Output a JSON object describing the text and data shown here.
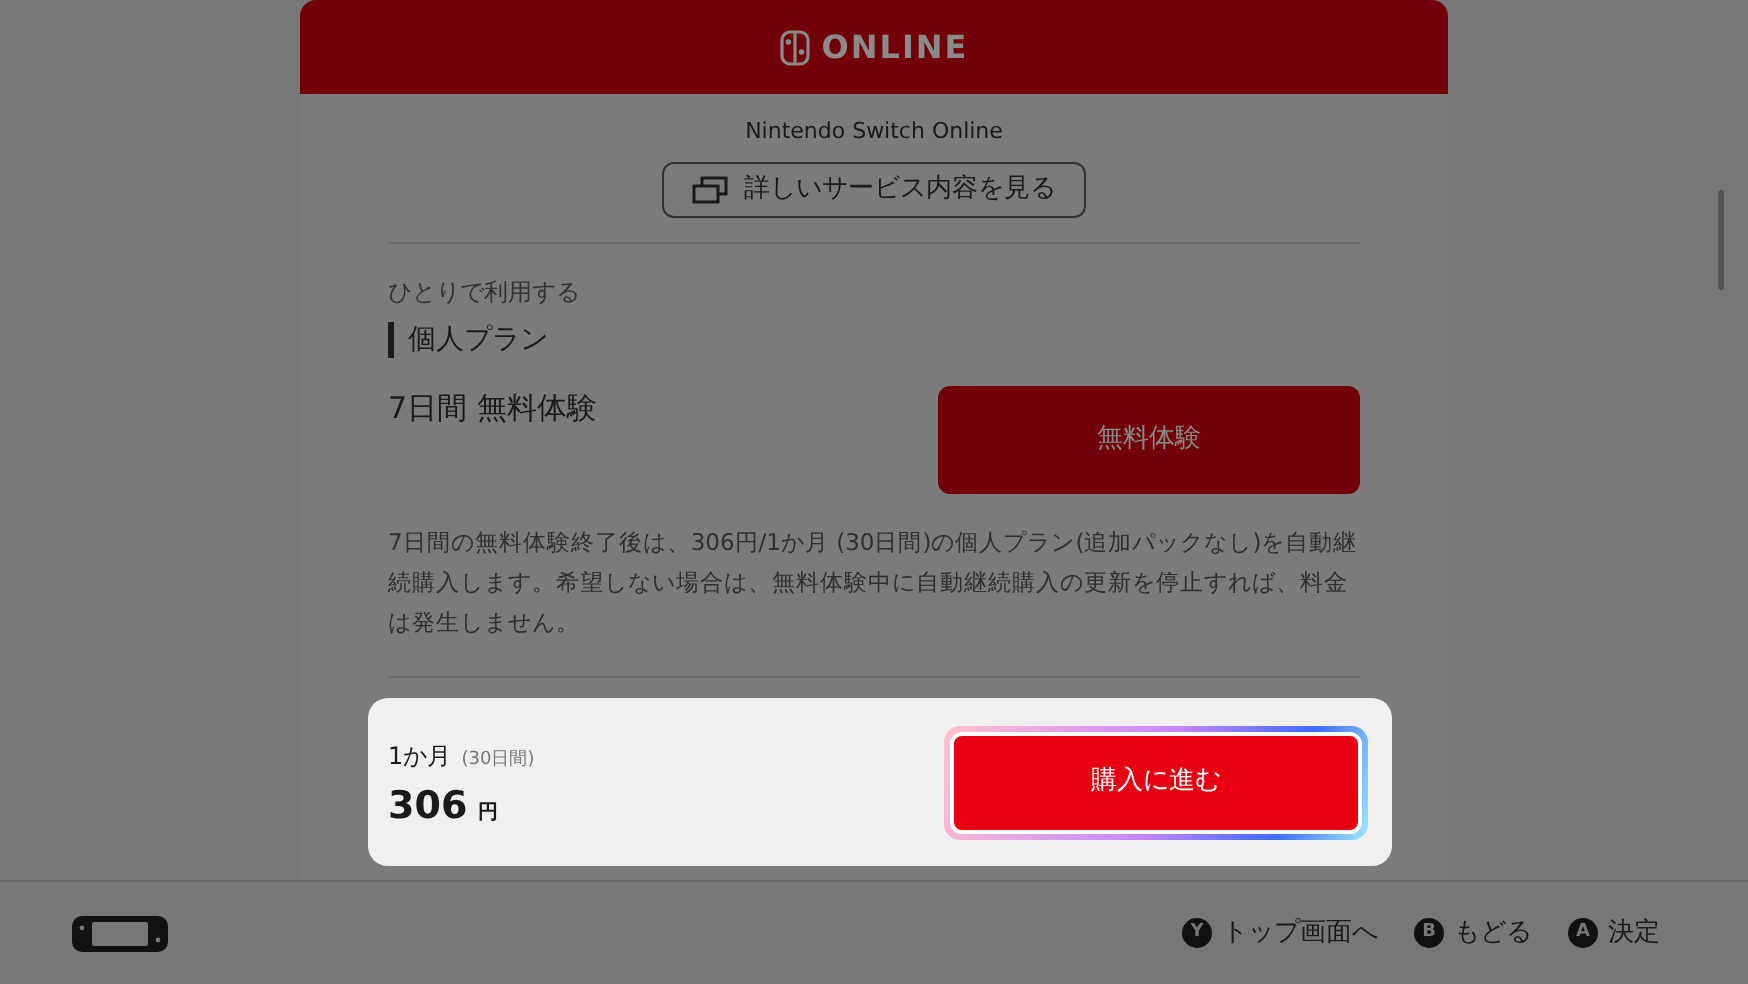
{
  "header": {
    "logo_text": "ONLINE"
  },
  "service_name": "Nintendo Switch Online",
  "details_button": {
    "label": "詳しいサービス内容を見る"
  },
  "plan": {
    "category": "ひとりで利用する",
    "name": "個人プラン",
    "trial_label": "7日間 無料体験",
    "trial_button": "無料体験",
    "description": "7日間の無料体験終了後は、306円/1か月 (30日間)の個人プラン(追加パックなし)を自動継続購入します。希望しない場合は、無料体験中に自動継続購入の更新を停止すれば、料金は発生しません。"
  },
  "purchase": {
    "period": "1か月",
    "period_note": "(30日間)",
    "price": "306",
    "currency": "円",
    "button": {
      "label": "購入に進む",
      "focused": true
    }
  },
  "footer": {
    "actions": [
      {
        "key": "Y",
        "label": "トップ画面へ"
      },
      {
        "key": "B",
        "label": "もどる"
      },
      {
        "key": "A",
        "label": "決定"
      }
    ]
  }
}
